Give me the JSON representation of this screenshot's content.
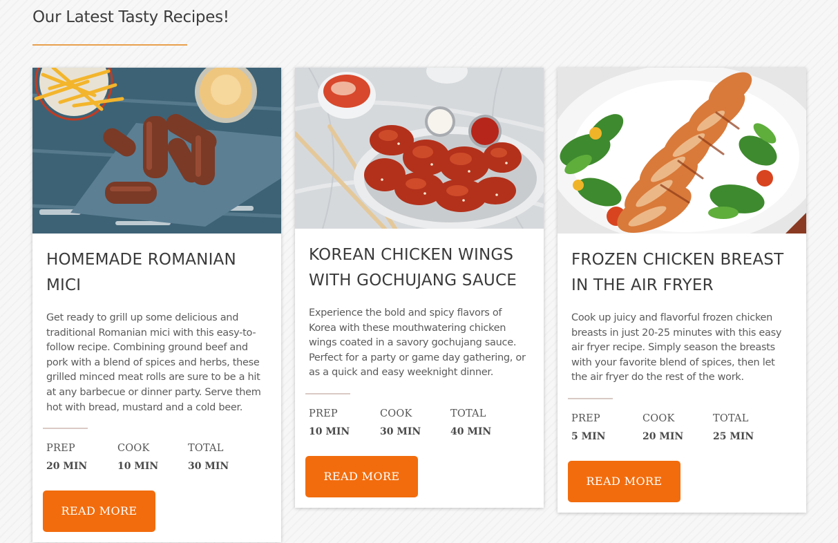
{
  "section": {
    "title": "Our Latest Tasty Recipes!",
    "accent_color": "#e8a04d"
  },
  "recipes": [
    {
      "title": "HOMEMADE ROMANIAN MICI",
      "description": "Get ready to grill up some delicious and traditional Romanian mici with this easy-to-follow recipe. Combining ground beef and pork with a blend of spices and herbs, these grilled minced meat rolls are sure to be a hit at any barbecue or dinner party. Serve them hot with bread, mustard and a cold beer.",
      "prep_label": "PREP",
      "prep_value": "20 MIN",
      "cook_label": "COOK",
      "cook_value": "10 MIN",
      "total_label": "TOTAL",
      "total_value": "30 MIN",
      "button_label": "READ MORE"
    },
    {
      "title": "KOREAN CHICKEN WINGS WITH GOCHUJANG SAUCE",
      "description": "Experience the bold and spicy flavors of Korea with these mouthwatering chicken wings coated in a savory gochujang sauce. Perfect for a party or game day gathering, or as a quick and easy weeknight dinner.",
      "prep_label": "PREP",
      "prep_value": "10 MIN",
      "cook_label": "COOK",
      "cook_value": "30 MIN",
      "total_label": "TOTAL",
      "total_value": "40 MIN",
      "button_label": "READ MORE"
    },
    {
      "title": "FROZEN CHICKEN BREAST IN THE AIR FRYER",
      "description": "Cook up juicy and flavorful frozen chicken breasts in just 20-25 minutes with this easy air fryer recipe. Simply season the breasts with your favorite blend of spices, then let the air fryer do the rest of the work.",
      "prep_label": "PREP",
      "prep_value": "5 MIN",
      "cook_label": "COOK",
      "cook_value": "20 MIN",
      "total_label": "TOTAL",
      "total_value": "25 MIN",
      "button_label": "READ MORE"
    }
  ],
  "colors": {
    "button": "#f26c0d",
    "divider": "#d9c9c4"
  }
}
